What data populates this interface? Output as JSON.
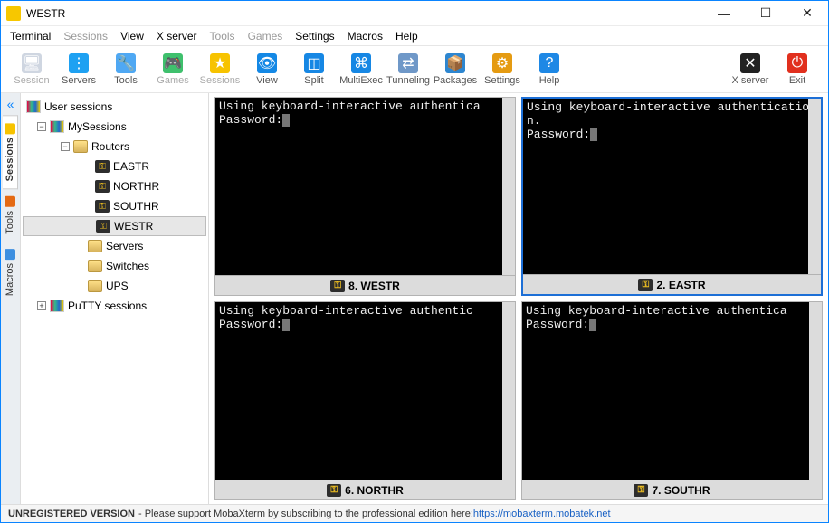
{
  "window": {
    "title": "WESTR"
  },
  "menu": [
    "Terminal",
    "Sessions",
    "View",
    "X server",
    "Tools",
    "Games",
    "Settings",
    "Macros",
    "Help"
  ],
  "menu_disabled": [
    1,
    4,
    5
  ],
  "toolbar": [
    {
      "label": "Session",
      "color": "#cfd6e1",
      "icon": "🖥",
      "disabled": true
    },
    {
      "label": "Servers",
      "color": "#1ea1f2",
      "icon": "⋮"
    },
    {
      "label": "Tools",
      "color": "#4fa8f3",
      "icon": "🔧"
    },
    {
      "label": "Games",
      "color": "#3fc06d",
      "icon": "🎮",
      "disabled": true
    },
    {
      "label": "Sessions",
      "color": "#f7c300",
      "icon": "★",
      "disabled": true
    },
    {
      "label": "View",
      "color": "#1488e5",
      "icon": "👁"
    },
    {
      "label": "Split",
      "color": "#1687e4",
      "icon": "◫"
    },
    {
      "label": "MultiExec",
      "color": "#1687e4",
      "icon": "⌘"
    },
    {
      "label": "Tunneling",
      "color": "#6f98c8",
      "icon": "⇄"
    },
    {
      "label": "Packages",
      "color": "#2d86d0",
      "icon": "📦"
    },
    {
      "label": "Settings",
      "color": "#e59b12",
      "icon": "⚙"
    },
    {
      "label": "Help",
      "color": "#1e88e5",
      "icon": "?"
    }
  ],
  "toolbar_right": [
    {
      "label": "X server",
      "color": "#222",
      "icon": "✕"
    },
    {
      "label": "Exit",
      "color": "#e1301e",
      "icon": "⏻"
    }
  ],
  "sidetabs": [
    {
      "label": "Sessions",
      "icon": "★",
      "icon_color": "#f7c300",
      "active": true
    },
    {
      "label": "Tools",
      "icon": "🔧",
      "icon_color": "#e46a14"
    },
    {
      "label": "Macros",
      "icon": "✈",
      "icon_color": "#3d8fe0"
    }
  ],
  "tree": {
    "root": {
      "label": "User sessions"
    },
    "my": {
      "label": "MySessions"
    },
    "routers": {
      "label": "Routers"
    },
    "leaves": [
      {
        "label": "EASTR"
      },
      {
        "label": "NORTHR"
      },
      {
        "label": "SOUTHR"
      },
      {
        "label": "WESTR",
        "selected": true
      }
    ],
    "siblings": [
      {
        "label": "Servers"
      },
      {
        "label": "Switches"
      },
      {
        "label": "UPS"
      }
    ],
    "putty": {
      "label": "PuTTY sessions"
    }
  },
  "panes": [
    {
      "title": "8. WESTR",
      "text": "Using keyboard-interactive authentica\nPassword:",
      "active": false
    },
    {
      "title": "2. EASTR",
      "text": "Using keyboard-interactive authentication.\nPassword:",
      "active": true
    },
    {
      "title": "6. NORTHR",
      "text": "Using keyboard-interactive authentic\nPassword:",
      "active": false
    },
    {
      "title": "7. SOUTHR",
      "text": "Using keyboard-interactive authentica\nPassword:",
      "active": false
    }
  ],
  "status": {
    "bold": "UNREGISTERED VERSION",
    "text": " -  Please support MobaXterm by subscribing to the professional edition here:  ",
    "link": "https://mobaxterm.mobatek.net"
  }
}
